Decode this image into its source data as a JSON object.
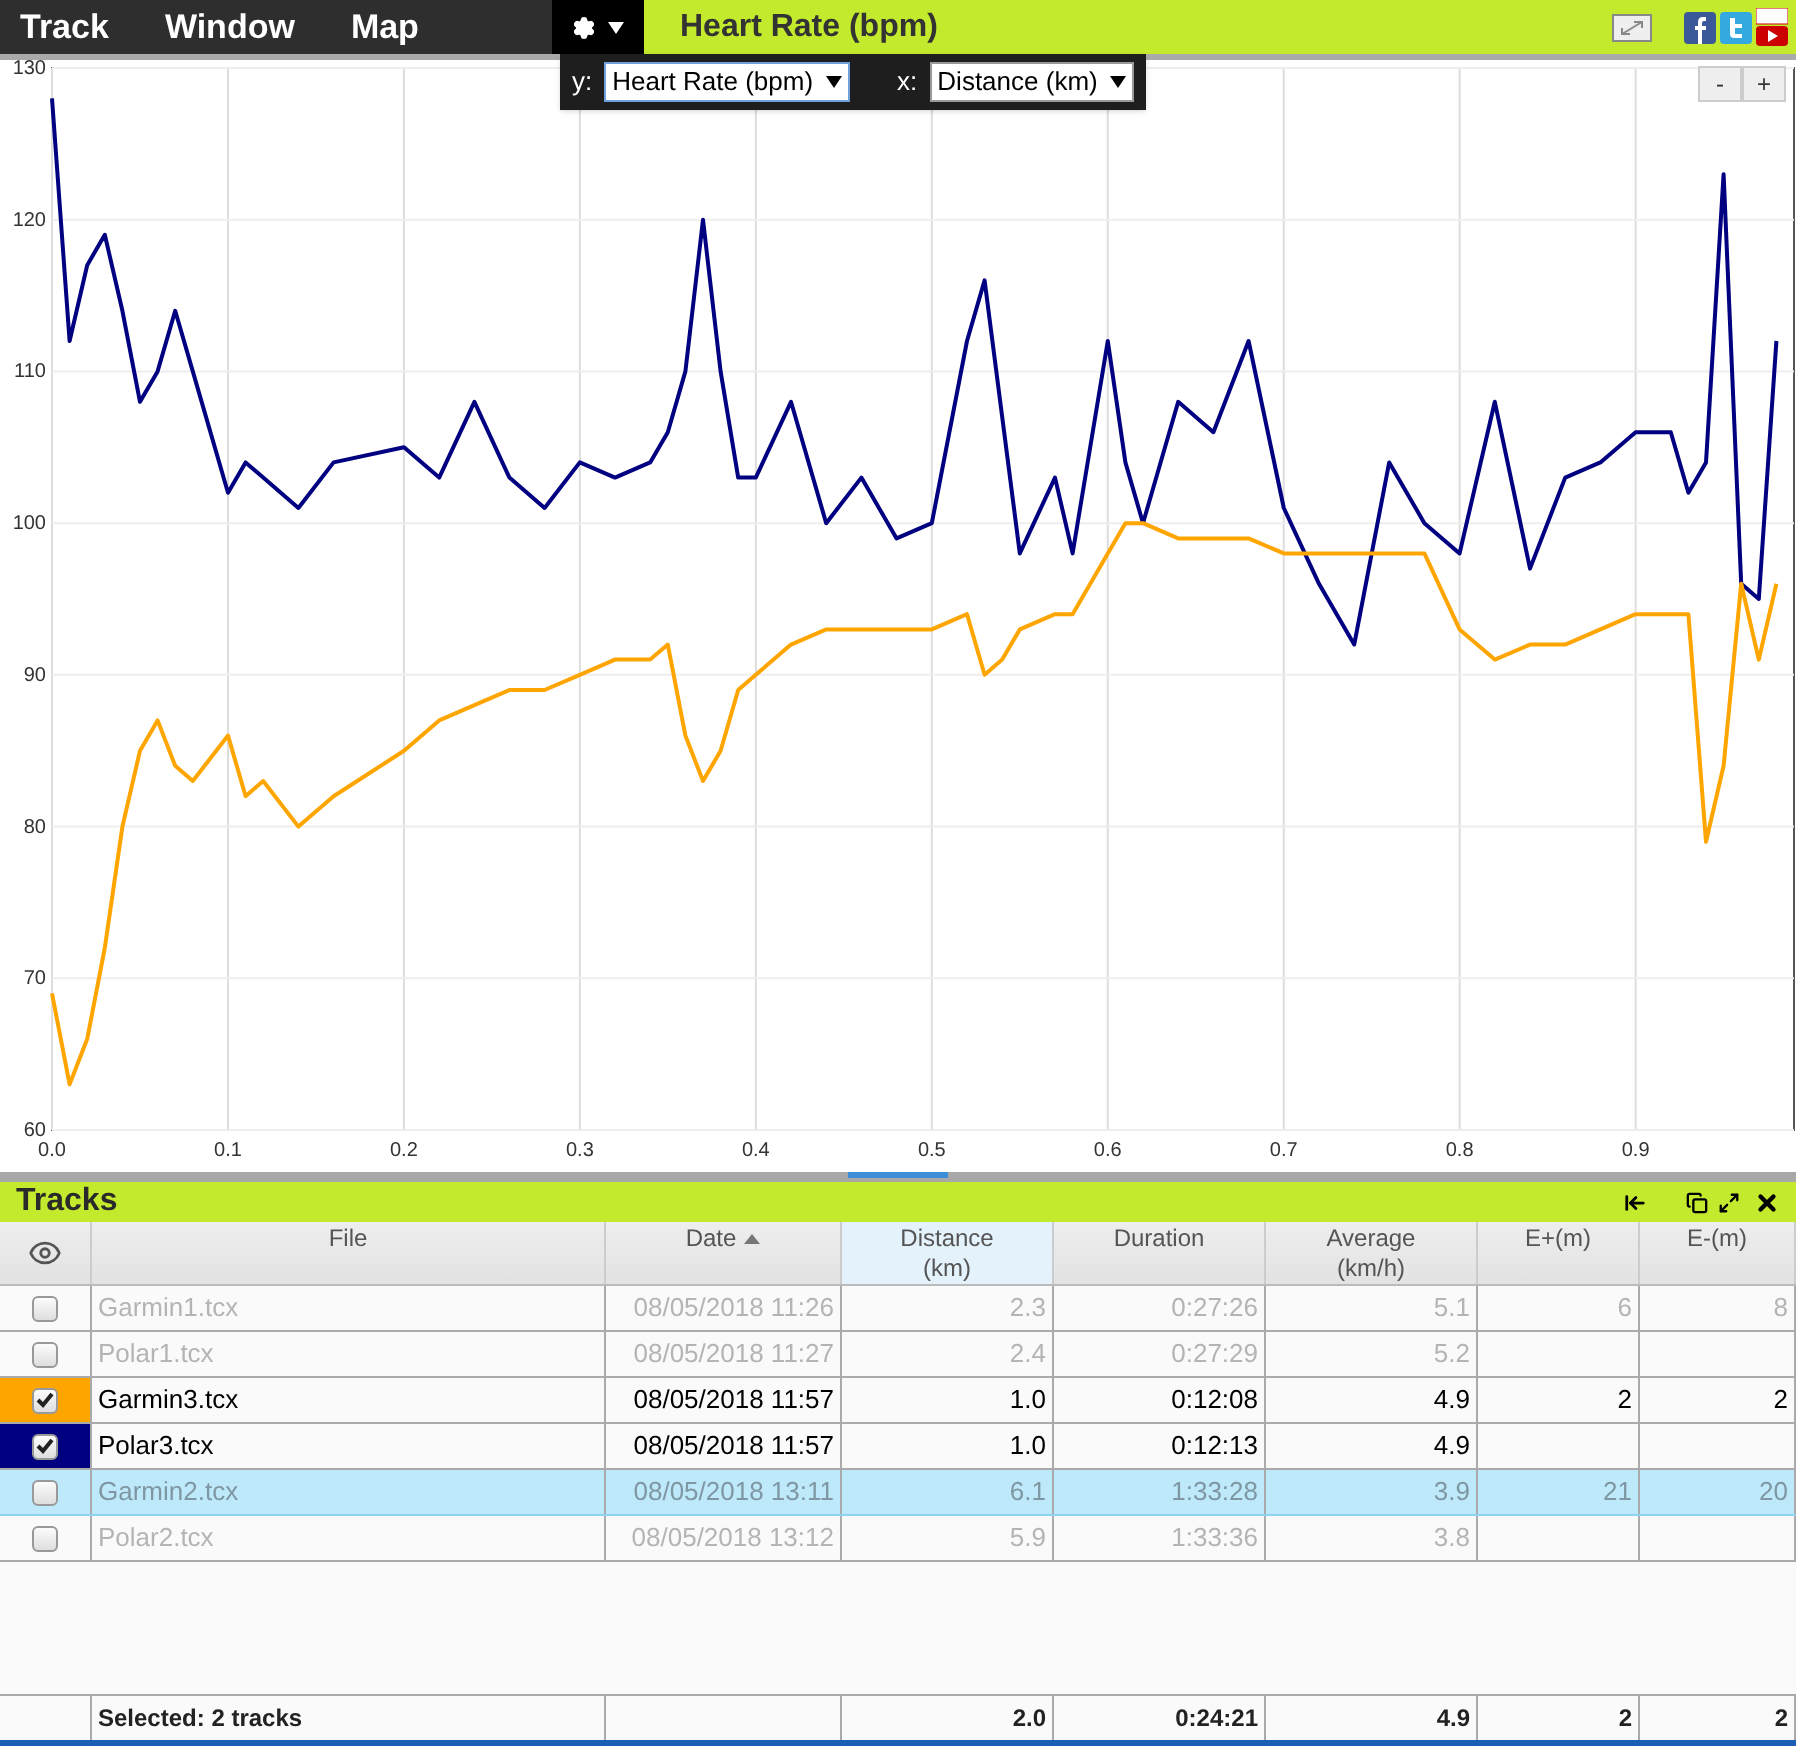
{
  "menu": [
    {
      "label": "Track"
    },
    {
      "label": "Window"
    },
    {
      "label": "Map"
    }
  ],
  "chart_panel": {
    "title": "Heart Rate (bpm)",
    "axis_selector": {
      "y_label": "y:",
      "y_value": "Heart Rate (bpm)",
      "x_label": "x:",
      "x_value": "Distance (km)"
    },
    "zoom_buttons": [
      "-",
      "+"
    ],
    "chart_data": {
      "type": "line",
      "grid": true,
      "xlim": [
        0,
        0.99
      ],
      "ylim": [
        60,
        130
      ],
      "xticks": [
        {
          "value": 0,
          "label": "0.0"
        },
        {
          "value": 0.1,
          "label": "0.1"
        },
        {
          "value": 0.2,
          "label": "0.2"
        },
        {
          "value": 0.3,
          "label": "0.3"
        },
        {
          "value": 0.4,
          "label": "0.4"
        },
        {
          "value": 0.5,
          "label": "0.5"
        },
        {
          "value": 0.6,
          "label": "0.6"
        },
        {
          "value": 0.7,
          "label": "0.7"
        },
        {
          "value": 0.8,
          "label": "0.8"
        },
        {
          "value": 0.9,
          "label": "0.9"
        }
      ],
      "yticks": [
        60,
        70,
        80,
        90,
        100,
        110,
        120,
        130
      ],
      "x": [
        0,
        0.01,
        0.02,
        0.03,
        0.04,
        0.05,
        0.06,
        0.07,
        0.08,
        0.1,
        0.11,
        0.12,
        0.14,
        0.16,
        0.2,
        0.22,
        0.24,
        0.26,
        0.28,
        0.3,
        0.32,
        0.34,
        0.35,
        0.36,
        0.37,
        0.38,
        0.39,
        0.4,
        0.42,
        0.44,
        0.46,
        0.48,
        0.5,
        0.52,
        0.53,
        0.54,
        0.55,
        0.57,
        0.58,
        0.6,
        0.61,
        0.62,
        0.64,
        0.66,
        0.68,
        0.7,
        0.72,
        0.74,
        0.76,
        0.78,
        0.8,
        0.82,
        0.84,
        0.86,
        0.88,
        0.9,
        0.92,
        0.93,
        0.94,
        0.95,
        0.96,
        0.97,
        0.98
      ],
      "series": [
        {
          "color": "#000080",
          "values": [
            128,
            112,
            117,
            119,
            114,
            108,
            110,
            114,
            110,
            102,
            104,
            103,
            101,
            104,
            105,
            103,
            108,
            103,
            101,
            104,
            103,
            104,
            106,
            110,
            120,
            110,
            103,
            103,
            108,
            100,
            103,
            99,
            100,
            112,
            116,
            107,
            98,
            103,
            98,
            112,
            104,
            100,
            108,
            106,
            112,
            101,
            96,
            92,
            104,
            100,
            98,
            108,
            97,
            103,
            104,
            106,
            106,
            102,
            104,
            123,
            96,
            95,
            112
          ]
        },
        {
          "color": "#ffa500",
          "values": [
            69,
            63,
            66,
            72,
            80,
            85,
            87,
            84,
            83,
            86,
            82,
            83,
            80,
            82,
            85,
            87,
            88,
            89,
            89,
            90,
            91,
            91,
            92,
            86,
            83,
            85,
            89,
            90,
            92,
            93,
            93,
            93,
            93,
            94,
            90,
            91,
            93,
            94,
            94,
            98,
            100,
            100,
            99,
            99,
            99,
            98,
            98,
            98,
            98,
            98,
            93,
            91,
            92,
            92,
            93,
            94,
            94,
            94,
            79,
            84,
            96,
            91,
            96
          ]
        }
      ]
    }
  },
  "tracks_panel": {
    "title": "Tracks",
    "columns": [
      {
        "label": "File"
      },
      {
        "label": "Date",
        "sorted": true
      },
      {
        "label": "Distance (km)",
        "hovered": true
      },
      {
        "label": "Duration"
      },
      {
        "label": "Average (km/h)"
      },
      {
        "label": "E+(m)"
      },
      {
        "label": "E-(m)"
      }
    ],
    "rows": [
      {
        "file": "Garmin1.tcx",
        "date": "08/05/2018 11:26",
        "distance": "2.3",
        "duration": "0:27:26",
        "average": "5.1",
        "e_plus": "6",
        "e_minus": "8",
        "checked": false,
        "selected": false
      },
      {
        "file": "Polar1.tcx",
        "date": "08/05/2018 11:27",
        "distance": "2.4",
        "duration": "0:27:29",
        "average": "5.2",
        "checked": false,
        "selected": false
      },
      {
        "file": "Garmin3.tcx",
        "date": "08/05/2018 11:57",
        "distance": "1.0",
        "duration": "0:12:08",
        "average": "4.9",
        "e_plus": "2",
        "e_minus": "2",
        "checked": true,
        "selected": false,
        "color": "#ffa500"
      },
      {
        "file": "Polar3.tcx",
        "date": "08/05/2018 11:57",
        "distance": "1.0",
        "duration": "0:12:13",
        "average": "4.9",
        "checked": true,
        "selected": false,
        "color": "#000080"
      },
      {
        "file": "Garmin2.tcx",
        "date": "08/05/2018 13:11",
        "distance": "6.1",
        "duration": "1:33:28",
        "average": "3.9",
        "e_plus": "21",
        "e_minus": "20",
        "checked": false,
        "selected": true
      },
      {
        "file": "Polar2.tcx",
        "date": "08/05/2018 13:12",
        "distance": "5.9",
        "duration": "1:33:36",
        "average": "3.8",
        "checked": false,
        "selected": false
      }
    ],
    "footer": {
      "label": "Selected: 2 tracks",
      "distance": "2.0",
      "duration": "0:24:21",
      "average": "4.9",
      "e_plus": "2",
      "e_minus": "2"
    }
  }
}
